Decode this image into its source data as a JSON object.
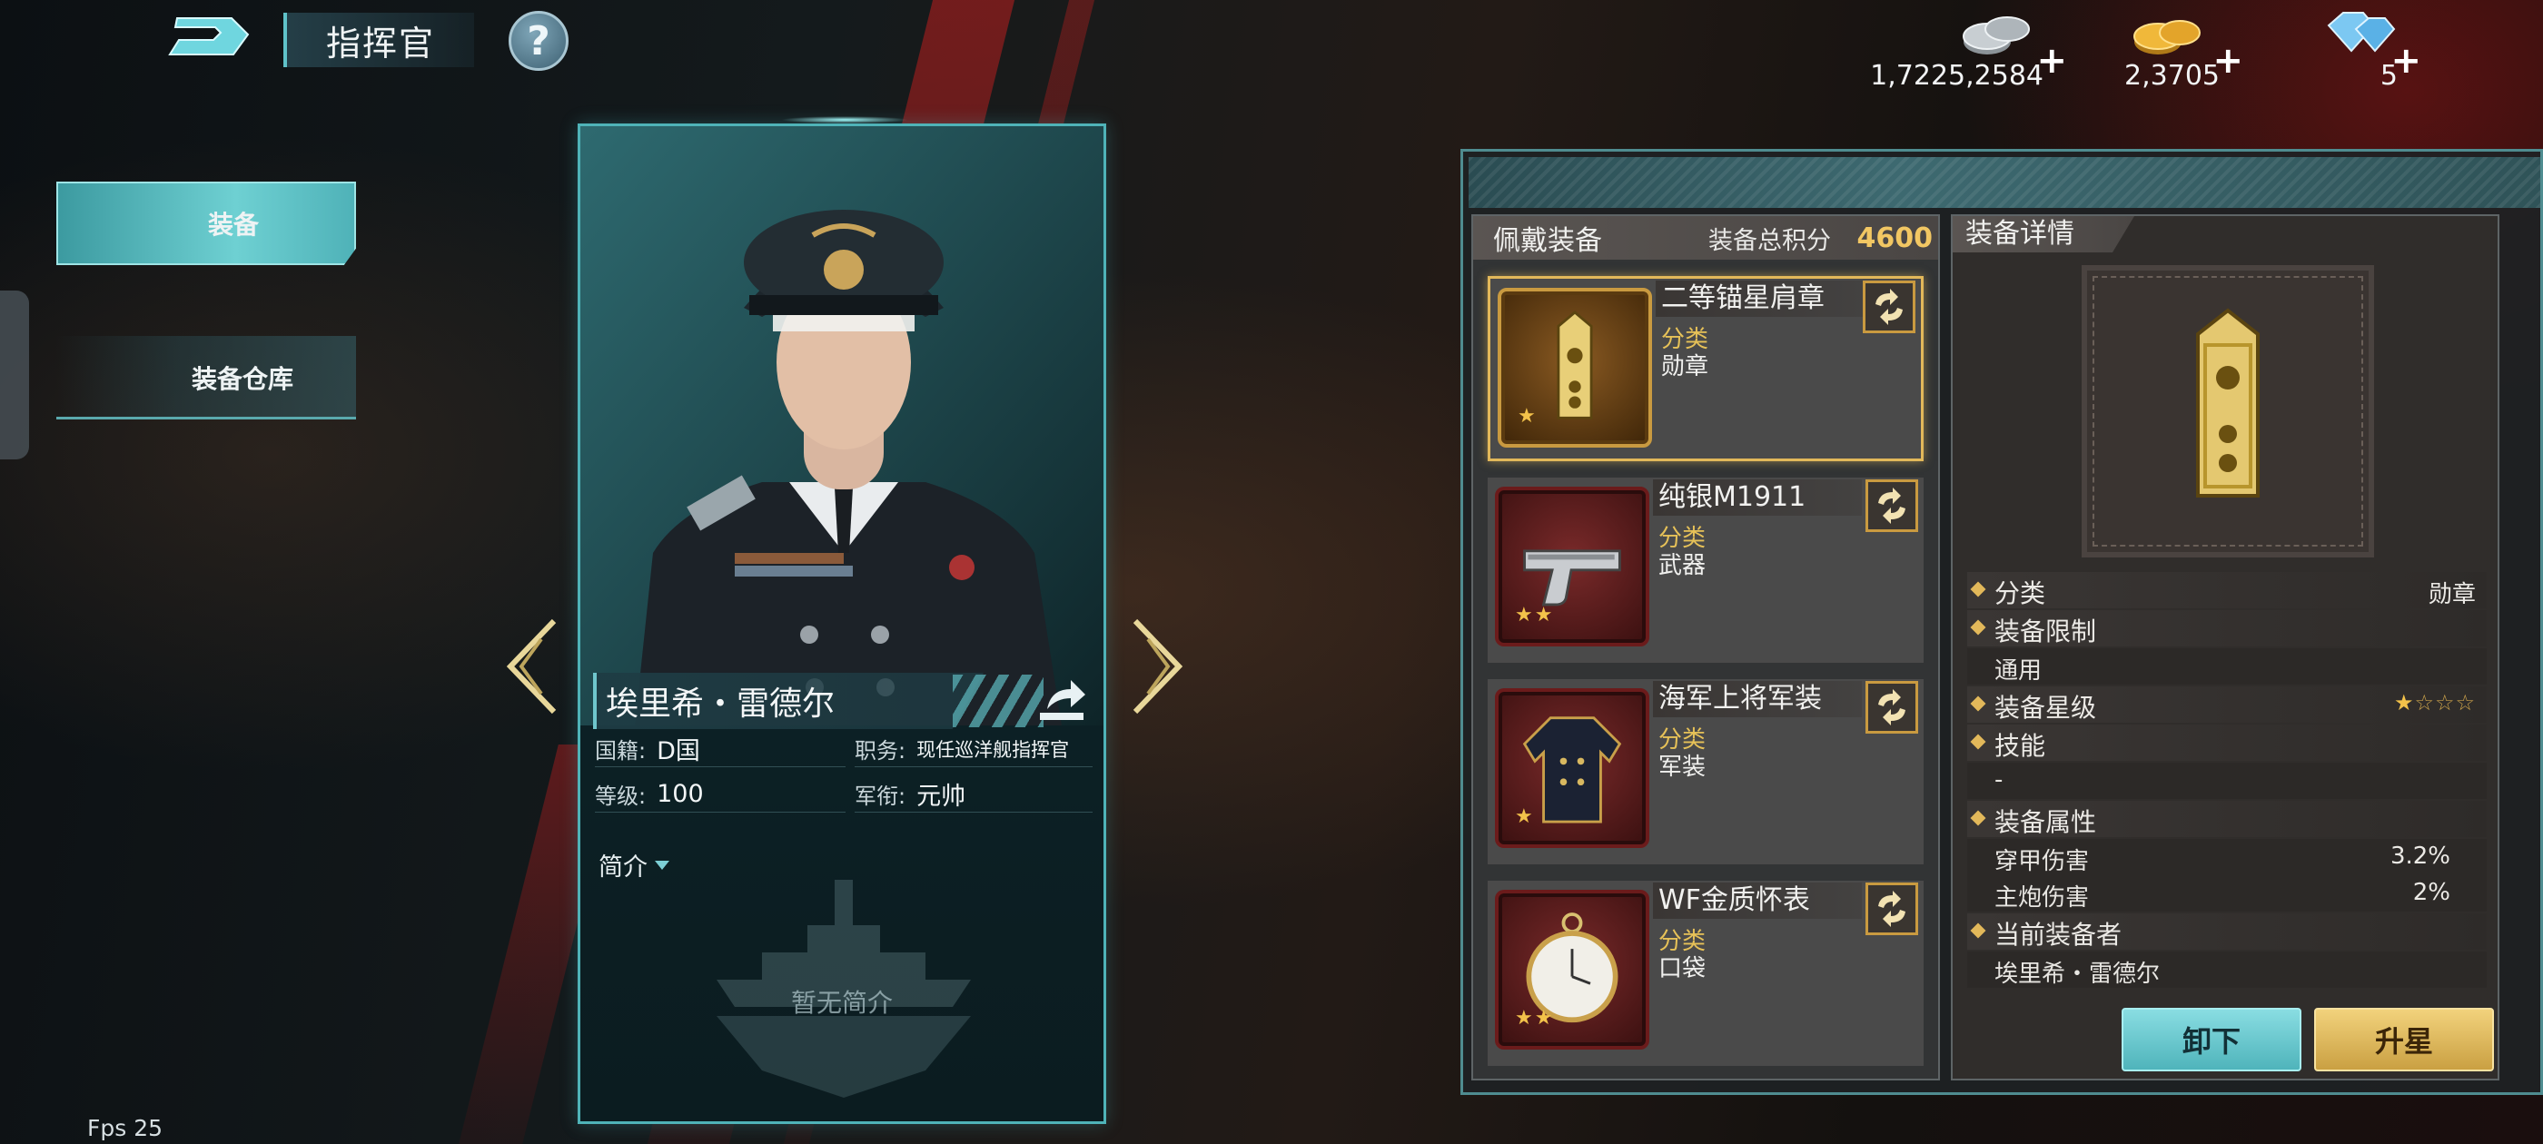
{
  "header": {
    "title": "指挥官",
    "help_symbol": "?"
  },
  "currencies": [
    {
      "icon": "silver-coins-icon",
      "value": "1,7225,2584",
      "plus": "+"
    },
    {
      "icon": "gold-coins-icon",
      "value": "2,3705",
      "plus": "+"
    },
    {
      "icon": "diamond-icon",
      "value": "5",
      "plus": "+"
    }
  ],
  "sidebar": {
    "items": [
      {
        "label": "装备",
        "active": true
      },
      {
        "label": "装备仓库",
        "active": false
      }
    ]
  },
  "commander": {
    "name": "埃里希・雷德尔",
    "nationality_label": "国籍:",
    "nationality": "D国",
    "position_label": "职务:",
    "position": "现任巡洋舰指挥官",
    "level_label": "等级:",
    "level": "100",
    "rank_label": "军衔:",
    "rank": "元帅",
    "intro_label": "简介",
    "no_intro": "暂无简介"
  },
  "equipped": {
    "title": "佩戴装备",
    "score_label": "装备总积分",
    "score": "4600",
    "items": [
      {
        "name": "二等锚星肩章",
        "category_label": "分类",
        "category": "勋章",
        "stars": "★",
        "icon": "shoulder-board-icon",
        "selected": true
      },
      {
        "name": "纯银M1911",
        "category_label": "分类",
        "category": "武器",
        "stars": "★★",
        "icon": "pistol-icon",
        "selected": false
      },
      {
        "name": "海军上将军装",
        "category_label": "分类",
        "category": "军装",
        "stars": "★",
        "icon": "uniform-icon",
        "selected": false
      },
      {
        "name": "WF金质怀表",
        "category_label": "分类",
        "category": "口袋",
        "stars": "★★",
        "icon": "pocket-watch-icon",
        "selected": false
      }
    ]
  },
  "detail": {
    "title": "装备详情",
    "category_label": "分类",
    "category": "勋章",
    "restriction_label": "装备限制",
    "restriction": "通用",
    "star_label": "装备星级",
    "stars_filled": "★",
    "stars_empty": "☆☆☆",
    "skill_label": "技能",
    "skill": "-",
    "attr_label": "装备属性",
    "attrs": [
      {
        "name": "穿甲伤害",
        "value": "3.2%"
      },
      {
        "name": "主炮伤害",
        "value": "2%"
      }
    ],
    "wearer_label": "当前装备者",
    "wearer": "埃里希・雷德尔"
  },
  "buttons": {
    "unequip": "卸下",
    "upgrade_star": "升星"
  },
  "fps": "Fps 25",
  "colors": {
    "accent_teal": "#4fb3b8",
    "gold": "#e2b85a",
    "star": "#f3c24a"
  }
}
